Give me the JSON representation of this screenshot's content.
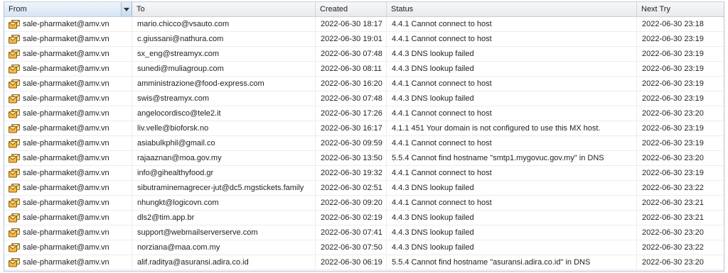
{
  "columns": {
    "from": "From",
    "to": "To",
    "created": "Created",
    "status": "Status",
    "next_try": "Next Try"
  },
  "icon": "envelope-queue-icon",
  "rows": [
    {
      "from": "sale-pharmaket@amv.vn",
      "to": "mario.chicco@vsauto.com",
      "created": "2022-06-30 18:17",
      "status": "4.4.1 Cannot connect to host",
      "next_try": "2022-06-30 23:18"
    },
    {
      "from": "sale-pharmaket@amv.vn",
      "to": "c.giussani@nathura.com",
      "created": "2022-06-30 19:01",
      "status": "4.4.1 Cannot connect to host",
      "next_try": "2022-06-30 23:19"
    },
    {
      "from": "sale-pharmaket@amv.vn",
      "to": "sx_eng@streamyx.com",
      "created": "2022-06-30 07:48",
      "status": "4.4.3 DNS lookup failed",
      "next_try": "2022-06-30 23:19"
    },
    {
      "from": "sale-pharmaket@amv.vn",
      "to": "sunedi@muliagroup.com",
      "created": "2022-06-30 08:11",
      "status": "4.4.3 DNS lookup failed",
      "next_try": "2022-06-30 23:19"
    },
    {
      "from": "sale-pharmaket@amv.vn",
      "to": "amministrazione@food-express.com",
      "created": "2022-06-30 16:20",
      "status": "4.4.1 Cannot connect to host",
      "next_try": "2022-06-30 23:19"
    },
    {
      "from": "sale-pharmaket@amv.vn",
      "to": "swis@streamyx.com",
      "created": "2022-06-30 07:48",
      "status": "4.4.3 DNS lookup failed",
      "next_try": "2022-06-30 23:19"
    },
    {
      "from": "sale-pharmaket@amv.vn",
      "to": "angelocordisco@tele2.it",
      "created": "2022-06-30 17:26",
      "status": "4.4.1 Cannot connect to host",
      "next_try": "2022-06-30 23:20"
    },
    {
      "from": "sale-pharmaket@amv.vn",
      "to": "liv.velle@bioforsk.no",
      "created": "2022-06-30 16:17",
      "status": "4.1.1 451 Your domain is not configured to use this MX host.",
      "next_try": "2022-06-30 23:19"
    },
    {
      "from": "sale-pharmaket@amv.vn",
      "to": "asiabulkphil@gmail.co",
      "created": "2022-06-30 09:59",
      "status": "4.4.1 Cannot connect to host",
      "next_try": "2022-06-30 23:19"
    },
    {
      "from": "sale-pharmaket@amv.vn",
      "to": "rajaaznan@moa.gov.my",
      "created": "2022-06-30 13:50",
      "status": "5.5.4 Cannot find hostname \"smtp1.mygovuc.gov.my\" in DNS",
      "next_try": "2022-06-30 23:20"
    },
    {
      "from": "sale-pharmaket@amv.vn",
      "to": "info@gihealthyfood.gr",
      "created": "2022-06-30 19:32",
      "status": "4.4.1 Cannot connect to host",
      "next_try": "2022-06-30 23:19"
    },
    {
      "from": "sale-pharmaket@amv.vn",
      "to": "sibutraminemagrecer-jut@dc5.mgstickets.family",
      "created": "2022-06-30 02:51",
      "status": "4.4.3 DNS lookup failed",
      "next_try": "2022-06-30 23:22"
    },
    {
      "from": "sale-pharmaket@amv.vn",
      "to": "nhungkt@logicovn.com",
      "created": "2022-06-30 09:20",
      "status": "4.4.1 Cannot connect to host",
      "next_try": "2022-06-30 23:21"
    },
    {
      "from": "sale-pharmaket@amv.vn",
      "to": "dls2@tim.app.br",
      "created": "2022-06-30 02:19",
      "status": "4.4.3 DNS lookup failed",
      "next_try": "2022-06-30 23:21"
    },
    {
      "from": "sale-pharmaket@amv.vn",
      "to": "support@webmailserverserve.com",
      "created": "2022-06-30 07:41",
      "status": "4.4.3 DNS lookup failed",
      "next_try": "2022-06-30 23:20"
    },
    {
      "from": "sale-pharmaket@amv.vn",
      "to": "norziana@maa.com.my",
      "created": "2022-06-30 07:50",
      "status": "4.4.3 DNS lookup failed",
      "next_try": "2022-06-30 23:22"
    },
    {
      "from": "sale-pharmaket@amv.vn",
      "to": "alif.raditya@asuransi.adira.co.id",
      "created": "2022-06-30 06:19",
      "status": "5.5.4 Cannot find hostname \"asuransi.adira.co.id\" in DNS",
      "next_try": "2022-06-30 23:20"
    }
  ]
}
